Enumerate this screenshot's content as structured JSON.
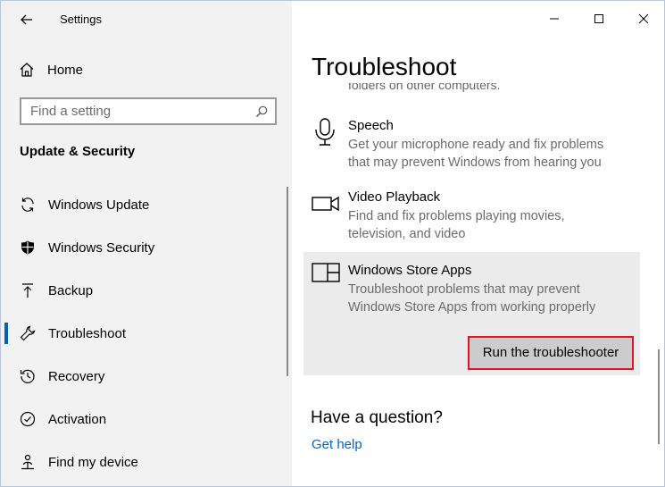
{
  "window": {
    "title": "Settings",
    "controls": {
      "minimize": "minimize",
      "maximize": "maximize",
      "close": "close"
    }
  },
  "sidebar": {
    "home_label": "Home",
    "search": {
      "placeholder": "Find a setting",
      "value": ""
    },
    "section_title": "Update & Security",
    "items": [
      {
        "label": "Windows Update",
        "icon": "sync-icon",
        "active": false
      },
      {
        "label": "Windows Security",
        "icon": "shield-icon",
        "active": false
      },
      {
        "label": "Backup",
        "icon": "upload-arrow-icon",
        "active": false
      },
      {
        "label": "Troubleshoot",
        "icon": "wrench-icon",
        "active": true
      },
      {
        "label": "Recovery",
        "icon": "history-icon",
        "active": false
      },
      {
        "label": "Activation",
        "icon": "check-circle-icon",
        "active": false
      },
      {
        "label": "Find my device",
        "icon": "person-pin-icon",
        "active": false
      }
    ]
  },
  "main": {
    "page_title": "Troubleshoot",
    "clipped_text": "folders on other computers.",
    "troubleshooters": [
      {
        "name": "Speech",
        "description": "Get your microphone ready and fix problems that may prevent Windows from hearing you",
        "icon": "microphone-icon"
      },
      {
        "name": "Video Playback",
        "description": "Find and fix problems playing movies, television, and video",
        "icon": "video-camera-icon"
      },
      {
        "name": "Windows Store Apps",
        "description": "Troubleshoot problems that may prevent Windows Store Apps from working properly",
        "icon": "store-apps-icon",
        "expanded": true,
        "button_label": "Run the troubleshooter"
      }
    ],
    "question_heading": "Have a question?",
    "help_link": "Get help"
  },
  "colors": {
    "sidebar_bg": "#f2f2f2",
    "accent": "#0063b1",
    "link": "#0066cc",
    "highlight_border": "#e81123",
    "panel_bg": "#ebebeb",
    "button_bg": "#cccccc"
  }
}
